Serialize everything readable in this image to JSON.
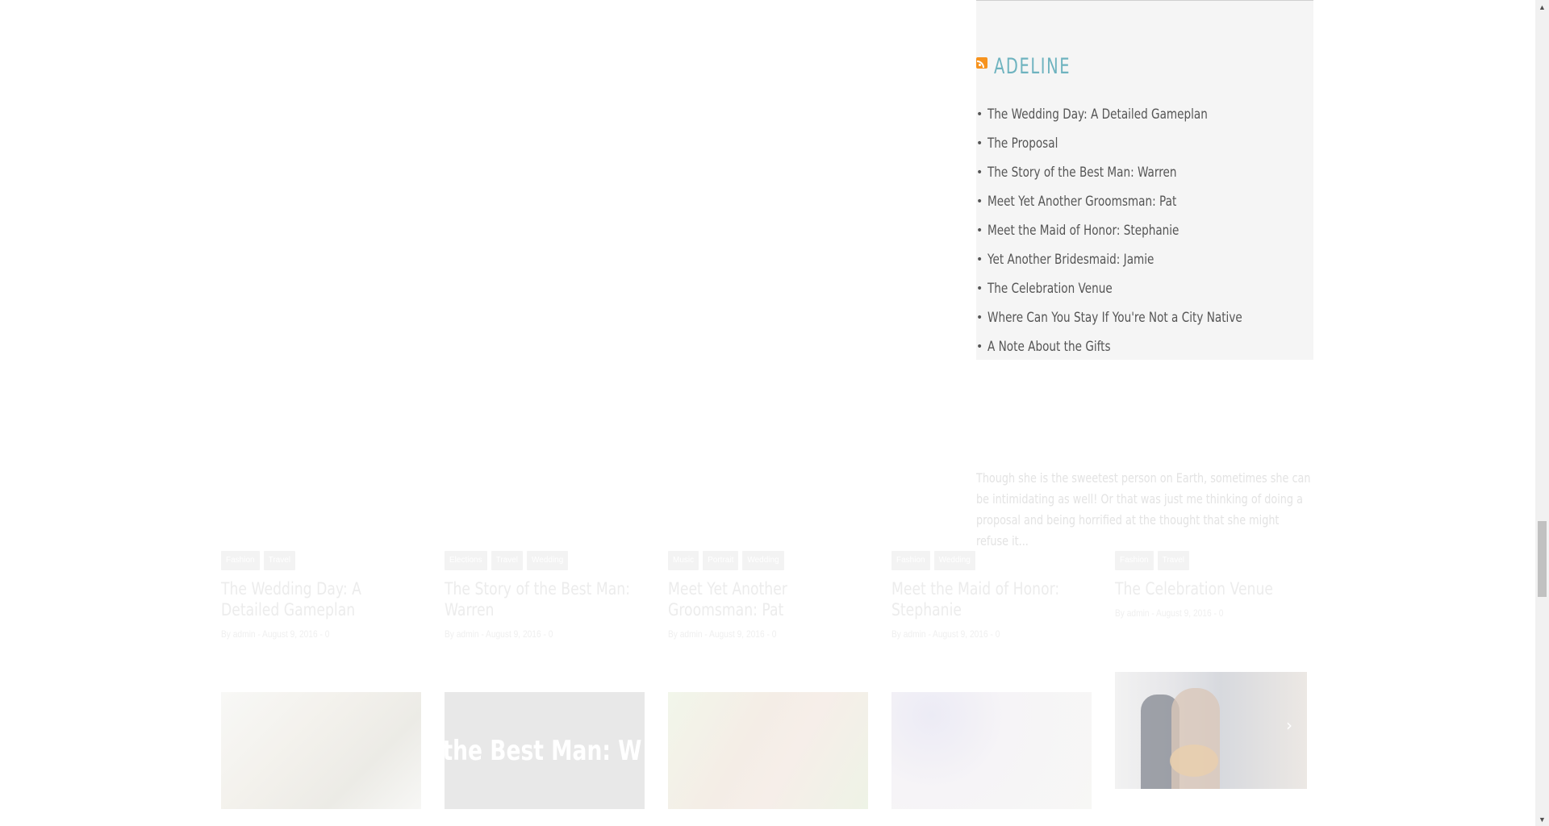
{
  "widget": {
    "title": "ADELINE",
    "items": [
      "The Wedding Day: A Detailed Gameplan",
      "The Proposal",
      "The Story of the Best Man: Warren",
      "Meet Yet Another Groomsman: Pat",
      "Meet the Maid of Honor: Stephanie",
      "Yet Another Bridesmaid: Jamie",
      "The Celebration Venue",
      "Where Can You Stay If You're Not a City Native",
      "A Note About the Gifts"
    ]
  },
  "excerpt": "Though she is the sweetest person on Earth, sometimes she can be intimidating as well! Or that was just me thinking of doing a proposal and being horrified at the thought that she might refuse it...",
  "cards": [
    {
      "tags": [
        "Fashion",
        "Travel"
      ],
      "title": "The Wedding Day: A Detailed Gameplan",
      "meta": "By admin - August 9, 2016 - 0"
    },
    {
      "tags": [
        "Elections",
        "Travel",
        "Wedding"
      ],
      "title": "The Story of the Best Man: Warren",
      "meta": "By admin - August 9, 2016 - 0"
    },
    {
      "tags": [
        "Music",
        "Portrait",
        "Wedding"
      ],
      "title": "Meet Yet Another Groomsman: Pat",
      "meta": "By admin - August 9, 2016 - 0"
    },
    {
      "tags": [
        "Fashion",
        "Wedding"
      ],
      "title": "Meet the Maid of Honor: Stephanie",
      "meta": "By admin - August 9, 2016 - 0"
    },
    {
      "tags": [
        "Fashion",
        "Travel"
      ],
      "title": "The Celebration Venue",
      "meta": "By admin - August 9, 2016 - 0"
    }
  ],
  "thumbs": {
    "second_overlay": "tory of the Best Man: W"
  },
  "colors": {
    "accent": "#6eb3bf",
    "rss": "#f7931e",
    "widget_bg": "#f5f5f5"
  }
}
